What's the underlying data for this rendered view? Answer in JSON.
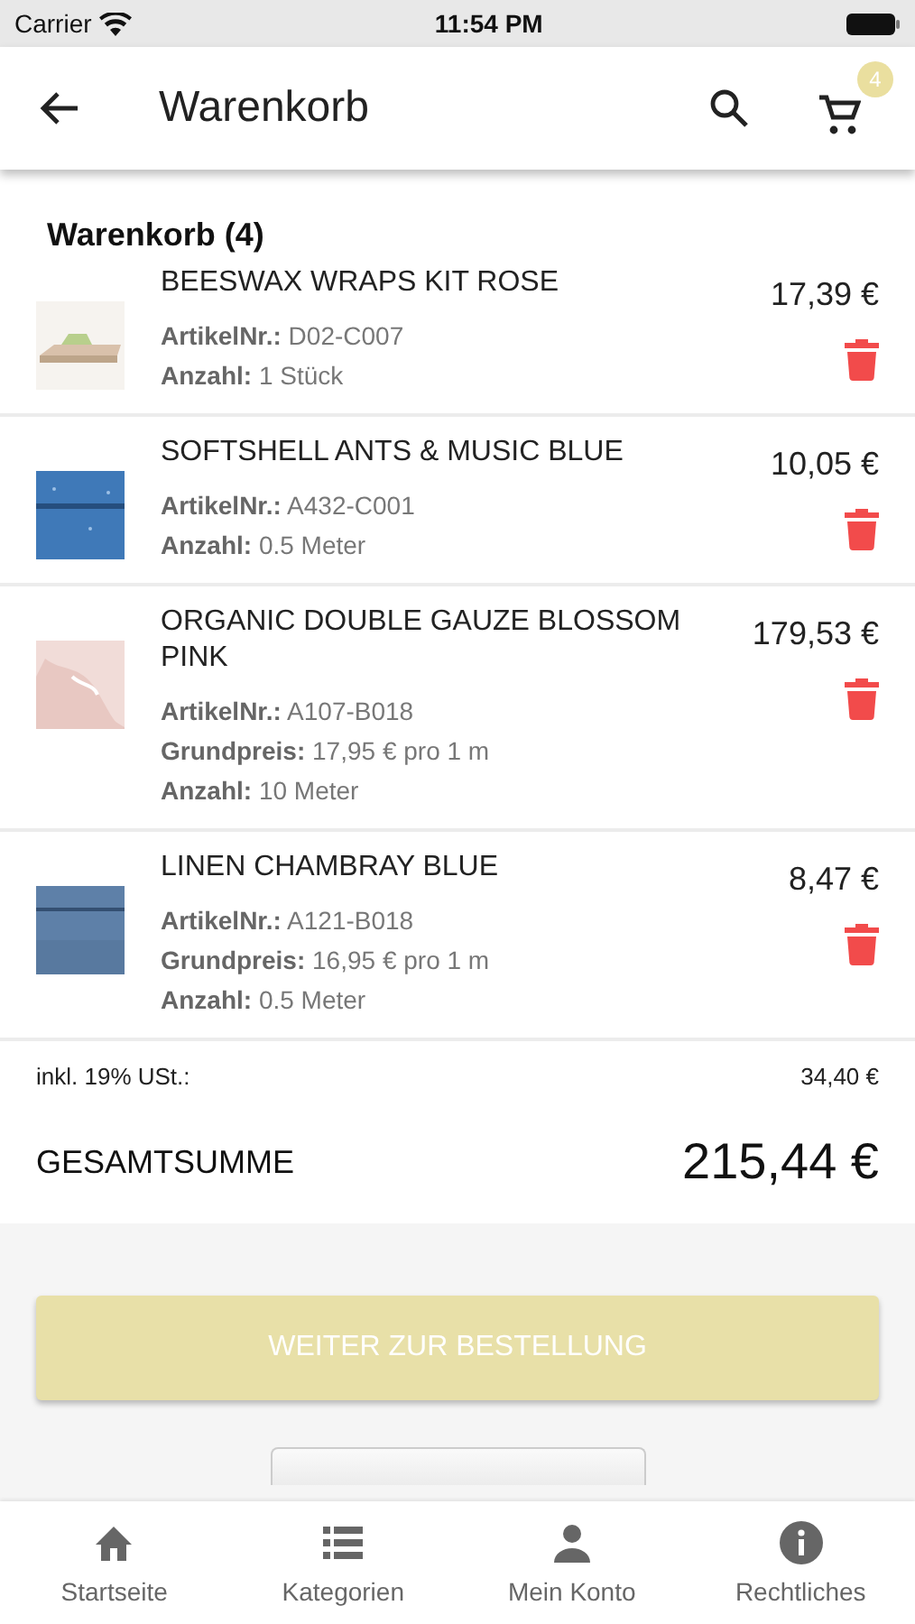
{
  "status_bar": {
    "carrier": "Carrier",
    "time": "11:54 PM"
  },
  "header": {
    "title": "Warenkorb",
    "cart_badge": "4"
  },
  "cart": {
    "title": "Warenkorb (4)",
    "items": [
      {
        "name": "BEESWAX WRAPS KIT ROSE",
        "price": "17,39 €",
        "image": {
          "kind": "picture"
        },
        "details": [
          "**ArtikelNr.:** D02-C007",
          "**Anzahl:** 1 Stück"
        ]
      },
      {
        "name": "SOFTSHELL ANTS & MUSIC BLUE",
        "price": "10,05 €",
        "image": {
          "kind": "picture"
        },
        "details": [
          "**ArtikelNr.:** A432-C001",
          "**Anzahl:** 0.5 Meter"
        ]
      },
      {
        "name": "ORGANIC DOUBLE GAUZE BLOSSOM PINK",
        "price": "179,53 €",
        "image": {
          "kind": "picture"
        },
        "details": [
          "**ArtikelNr.:** A107-B018",
          "**Grundpreis:** 17,95 € pro 1 m",
          "**Anzahl:** 10 Meter"
        ]
      },
      {
        "name": "LINEN CHAMBRAY BLUE",
        "price": "8,47 €",
        "image": {
          "kind": "picture"
        },
        "details": [
          "**ArtikelNr.:** A121-B018",
          "**Grundpreis:** 16,95 € pro 1 m",
          "**Anzahl:** 0.5 Meter"
        ]
      }
    ]
  },
  "summary": {
    "tax_label": "inkl. 19% USt.:",
    "tax_value": "34,40 €",
    "total_label": "GESAMTSUMME",
    "total_value": "215,44 €"
  },
  "checkout_button": {
    "label": "WEITER ZUR BESTELLUNG",
    "disabled": true
  },
  "tab_bar": [
    {
      "label": "Startseite"
    },
    {
      "label": "Kategorien"
    },
    {
      "label": "Mein Konto"
    },
    {
      "label": "Rechtliches"
    }
  ]
}
